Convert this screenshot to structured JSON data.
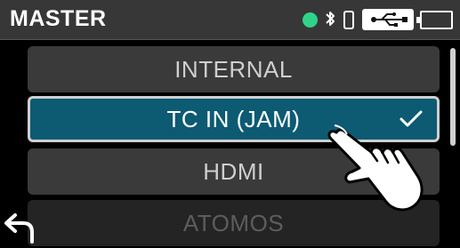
{
  "header": {
    "title": "MASTER",
    "status_icons": [
      "connection-dot",
      "bluetooth-icon",
      "phone-icon",
      "usb-icon",
      "battery-icon"
    ],
    "status_dot_color": "#2fd48a"
  },
  "list": {
    "items": [
      {
        "label": "INTERNAL",
        "state": "normal"
      },
      {
        "label": "TC IN (JAM)",
        "state": "selected"
      },
      {
        "label": "HDMI",
        "state": "normal"
      },
      {
        "label": "ATOMOS",
        "state": "disabled"
      }
    ],
    "selected_color": "#0d5a73"
  },
  "icons": {
    "back": "back-arrow-icon",
    "check": "checkmark-icon",
    "hand": "tap-hand-icon"
  }
}
